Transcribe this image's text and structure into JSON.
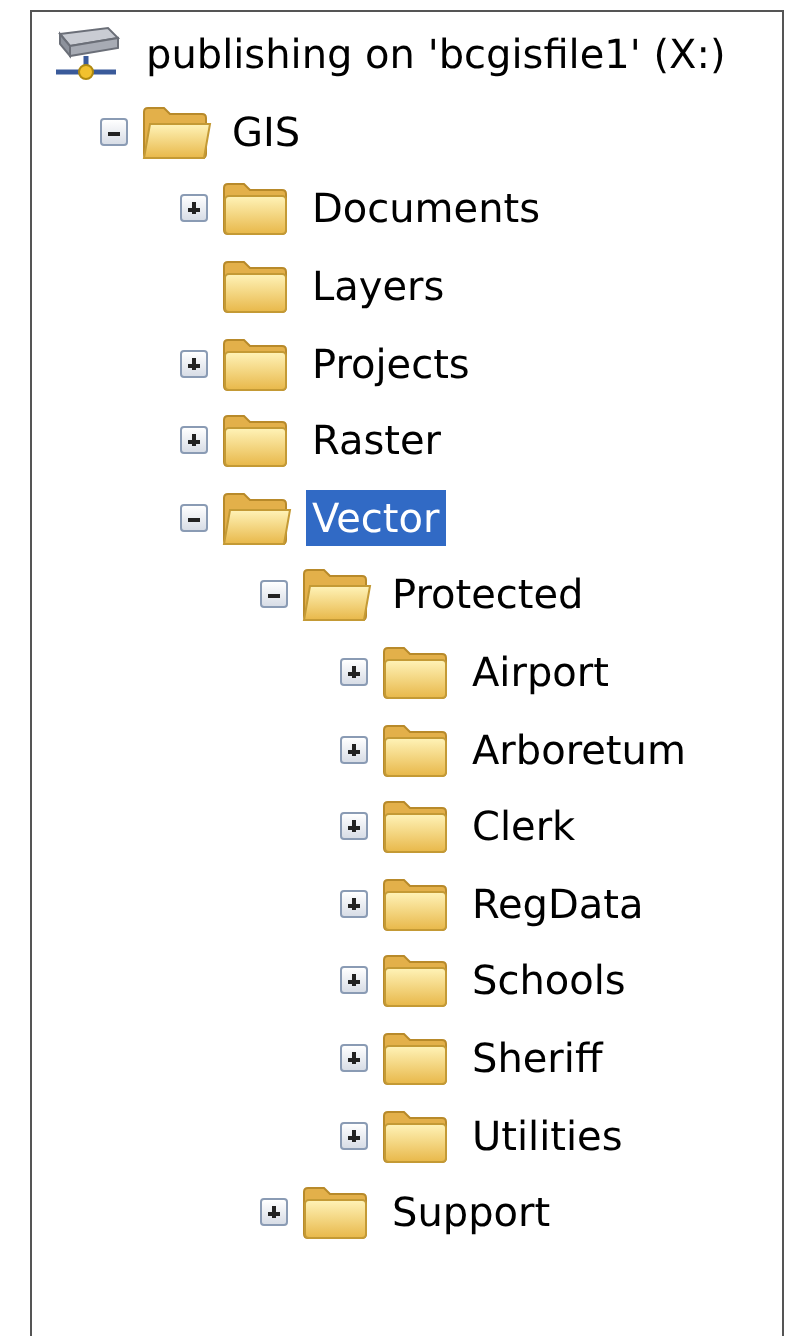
{
  "tree": {
    "kind": "drive",
    "label": "publishing on 'bcgisfile1' (X:)",
    "selected": false,
    "children": [
      {
        "kind": "folder",
        "label": "GIS",
        "expanded": true,
        "selected": false,
        "children": [
          {
            "kind": "folder",
            "label": "Documents",
            "expanded": false,
            "selected": false
          },
          {
            "kind": "leaf",
            "label": "Layers",
            "selected": false
          },
          {
            "kind": "folder",
            "label": "Projects",
            "expanded": false,
            "selected": false
          },
          {
            "kind": "folder",
            "label": "Raster",
            "expanded": false,
            "selected": false
          },
          {
            "kind": "folder",
            "label": "Vector",
            "expanded": true,
            "selected": true,
            "children": [
              {
                "kind": "folder",
                "label": "Protected",
                "expanded": true,
                "selected": false,
                "children": [
                  {
                    "kind": "folder",
                    "label": "Airport",
                    "expanded": false,
                    "selected": false
                  },
                  {
                    "kind": "folder",
                    "label": "Arboretum",
                    "expanded": false,
                    "selected": false
                  },
                  {
                    "kind": "folder",
                    "label": "Clerk",
                    "expanded": false,
                    "selected": false
                  },
                  {
                    "kind": "folder",
                    "label": "RegData",
                    "expanded": false,
                    "selected": false
                  },
                  {
                    "kind": "folder",
                    "label": "Schools",
                    "expanded": false,
                    "selected": false
                  },
                  {
                    "kind": "folder",
                    "label": "Sheriff",
                    "expanded": false,
                    "selected": false
                  },
                  {
                    "kind": "folder",
                    "label": "Utilities",
                    "expanded": false,
                    "selected": false
                  }
                ]
              },
              {
                "kind": "folder",
                "label": "Support",
                "expanded": false,
                "selected": false
              }
            ]
          }
        ]
      }
    ]
  }
}
